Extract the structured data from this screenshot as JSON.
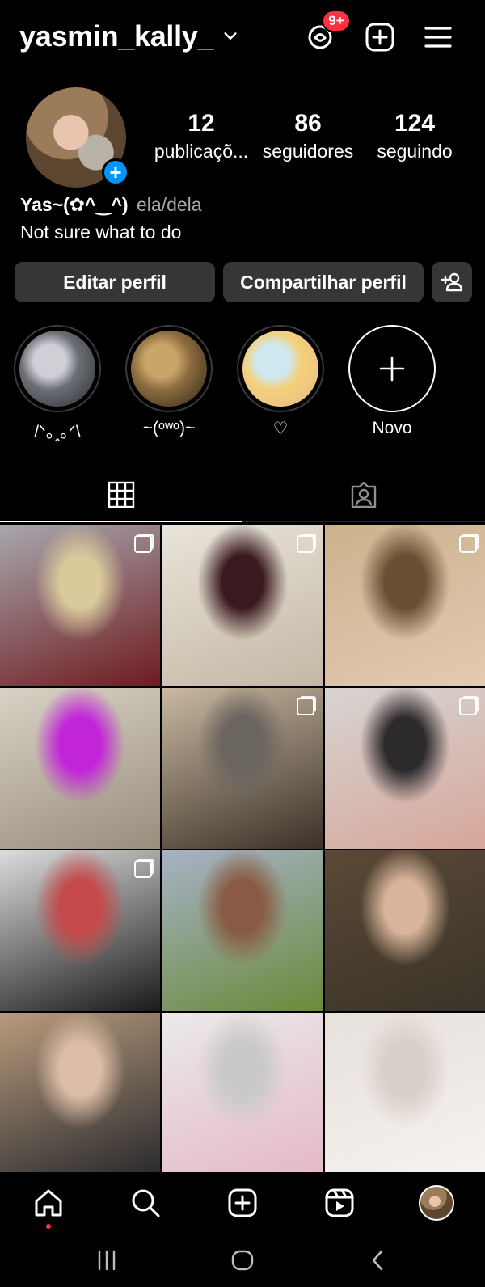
{
  "header": {
    "username": "yasmin_kally_",
    "threads_badge": "9+",
    "icons": [
      "threads-icon",
      "create-icon",
      "menu-icon"
    ]
  },
  "profile": {
    "stats": [
      {
        "value": "12",
        "label": "publicaçõ..."
      },
      {
        "value": "86",
        "label": "seguidores"
      },
      {
        "value": "124",
        "label": "seguindo"
      }
    ],
    "display_name": "Yas~(✿^‿^)",
    "pronouns": "ela/dela",
    "bio": "Not sure what to do"
  },
  "buttons": {
    "edit": "Editar perfil",
    "share": "Compartilhar perfil"
  },
  "highlights": [
    {
      "caption": "/ᐠ｡ꞈ｡ᐟ\\",
      "colors": [
        "#cfcfd6",
        "#6b6f74",
        "#2c2a30"
      ]
    },
    {
      "caption": "~(ᵒʷᵒ)~",
      "colors": [
        "#caa56a",
        "#8d6d3f",
        "#2a2219"
      ]
    },
    {
      "caption": "♡",
      "colors": [
        "#cfe8f0",
        "#f5d07a",
        "#e7b98a"
      ]
    },
    {
      "caption": "Novo"
    }
  ],
  "tabs": [
    "grid-icon",
    "tagged-icon"
  ],
  "grid": [
    {
      "colors": [
        "#a7a7ad",
        "#d9c99b",
        "#6e1c20"
      ],
      "multi": true
    },
    {
      "colors": [
        "#e8e4da",
        "#3a1a1f",
        "#c4b7a4"
      ],
      "multi": true
    },
    {
      "colors": [
        "#ccb28d",
        "#6a4f33",
        "#e3cab2"
      ],
      "multi": true
    },
    {
      "colors": [
        "#d8d2c6",
        "#c224d8",
        "#9a8e7c"
      ],
      "multi": false
    },
    {
      "colors": [
        "#c9b9a1",
        "#6b6560",
        "#3b3128"
      ],
      "multi": true
    },
    {
      "colors": [
        "#d7d4d2",
        "#2d2a2e",
        "#d6a79a"
      ],
      "multi": true
    },
    {
      "colors": [
        "#dcdcdc",
        "#c44a4a",
        "#1a1a1a"
      ],
      "multi": true
    },
    {
      "colors": [
        "#a7b2c6",
        "#8a5b44",
        "#6c8a3a"
      ],
      "multi": false
    },
    {
      "colors": [
        "#5a4936",
        "#d8b49a",
        "#3a3328"
      ],
      "multi": false
    },
    {
      "colors": [
        "#b99b7c",
        "#dcbda7",
        "#2a2b2e"
      ],
      "multi": false
    },
    {
      "colors": [
        "#eaeaea",
        "#c9c9c9",
        "#e5b8c9"
      ],
      "multi": false
    },
    {
      "colors": [
        "#e7e1dc",
        "#d8cfc8",
        "#f6f2ef"
      ],
      "multi": false
    }
  ],
  "bottom_nav": [
    "home-icon",
    "search-icon",
    "create-icon",
    "reels-icon",
    "profile-avatar"
  ],
  "system_nav": [
    "recents-icon",
    "home-button-icon",
    "back-icon"
  ],
  "colors": {
    "accent": "#0095f6",
    "badge": "#ff3040",
    "button_bg": "#363636"
  }
}
